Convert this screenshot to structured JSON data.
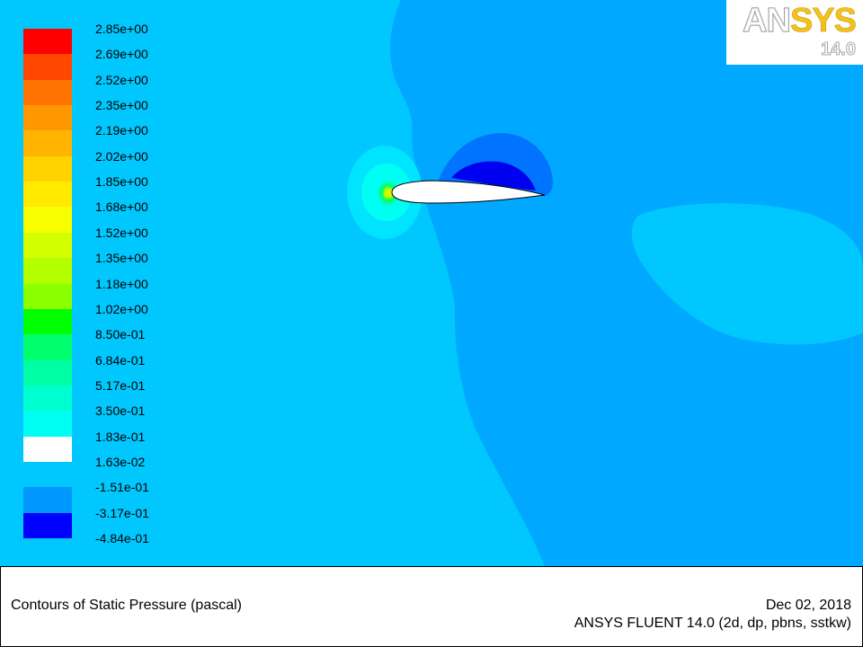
{
  "chart_data": {
    "type": "heatmap",
    "title": "Contours of Static Pressure (pascal)",
    "quantity": "Static Pressure",
    "units": "pascal",
    "colorbar_levels": [
      {
        "label": "2.85e+00",
        "value": 2.85,
        "color": "#ff0000"
      },
      {
        "label": "2.69e+00",
        "value": 2.69,
        "color": "#ff4700"
      },
      {
        "label": "2.52e+00",
        "value": 2.52,
        "color": "#ff7300"
      },
      {
        "label": "2.35e+00",
        "value": 2.35,
        "color": "#ff9800"
      },
      {
        "label": "2.19e+00",
        "value": 2.19,
        "color": "#ffb500"
      },
      {
        "label": "2.02e+00",
        "value": 2.02,
        "color": "#ffd200"
      },
      {
        "label": "1.85e+00",
        "value": 1.85,
        "color": "#ffea00"
      },
      {
        "label": "1.68e+00",
        "value": 1.68,
        "color": "#f7ff00"
      },
      {
        "label": "1.52e+00",
        "value": 1.52,
        "color": "#d4ff00"
      },
      {
        "label": "1.35e+00",
        "value": 1.35,
        "color": "#b3ff00"
      },
      {
        "label": "1.18e+00",
        "value": 1.18,
        "color": "#8cff00"
      },
      {
        "label": "1.02e+00",
        "value": 1.02,
        "color": "#00ff00"
      },
      {
        "label": "8.50e-01",
        "value": 0.85,
        "color": "#00ff6e"
      },
      {
        "label": "6.84e-01",
        "value": 0.684,
        "color": "#00ffa5"
      },
      {
        "label": "5.17e-01",
        "value": 0.517,
        "color": "#00ffcf"
      },
      {
        "label": "3.50e-01",
        "value": 0.35,
        "color": "#00fff3"
      },
      {
        "label": "1.83e-01",
        "value": 0.183,
        "color": "#00e4ff"
      },
      {
        "label": "1.63e-02",
        "value": 0.0163,
        "color": "#00c8ff"
      },
      {
        "label": "-1.51e-01",
        "value": -0.151,
        "color": "#0097ff"
      },
      {
        "label": "-3.17e-01",
        "value": -0.317,
        "color": "#0059ff"
      },
      {
        "label": "-4.84e-01",
        "value": -0.484,
        "color": "#0000ff"
      }
    ]
  },
  "logo": {
    "brand_part1": "AN",
    "brand_part2": "SYS",
    "version": "14.0"
  },
  "footer": {
    "caption": "Contours of Static Pressure (pascal)",
    "date": "Dec 02, 2018",
    "solver": "ANSYS FLUENT 14.0 (2d, dp, pbns, sstkw)"
  }
}
